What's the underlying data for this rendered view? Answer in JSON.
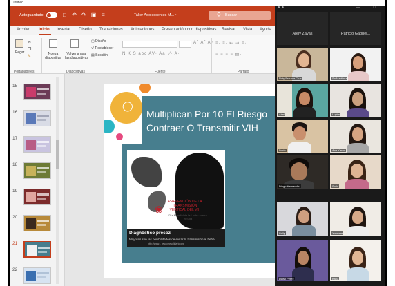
{
  "window": {
    "label": "Untitled"
  },
  "powerpoint": {
    "autosave_label": "Autoguardado",
    "doc_title": "Taller Adolescentes  M... •",
    "search_placeholder": "Buscar",
    "tabs": [
      "Archivo",
      "Inicio",
      "Insertar",
      "Diseño",
      "Transiciones",
      "Animaciones",
      "Presentación con diapositivas",
      "Revisar",
      "Vista",
      "Ayuda"
    ],
    "active_tab": "Inicio",
    "ribbon": {
      "paste": "Pegar",
      "new_slide": "Nueva diapositiva",
      "reuse_slides": "Volver a usar las diapositivas",
      "layout": "Diseño",
      "reset": "Restablecer",
      "section": "Sección",
      "groups": [
        "Portapapeles",
        "Diapositivas",
        "Fuente",
        "Párrafo"
      ]
    },
    "thumbnails": [
      {
        "number": "15",
        "color": "#6b3a56",
        "accent": "#c93b6b"
      },
      {
        "number": "16",
        "color": "#d9dce6",
        "accent": "#5a79b8"
      },
      {
        "number": "17",
        "color": "#c9c4e0",
        "accent": "#b85c86"
      },
      {
        "number": "18",
        "color": "#6d7b36",
        "accent": "#c7b25a"
      },
      {
        "number": "19",
        "color": "#7c2b2b",
        "accent": "#e0a7a0"
      },
      {
        "number": "20",
        "color": "#b88a3a",
        "accent": "#3a2a1e"
      },
      {
        "number": "21",
        "color": "#477e8e",
        "accent": "#1a1a1a",
        "active": true
      },
      {
        "number": "22",
        "color": "#d7e3f1",
        "accent": "#3a6fb0"
      }
    ],
    "slide": {
      "title_line1": "Multiplican Por 10 El Riesgo",
      "title_line2": "Contraer O Transmitir VIH",
      "image_text_1": "PREVENCIÓN DE LA TRANSMISIÓN VERTICAL DEL VIH",
      "image_text_2": "Día Mundial de la Lucha contra el Sida",
      "caption_1": "Diagnóstico precoz",
      "caption_2": "Mayores son las posibilidades de evitar la transmisión al bebé",
      "caption_3": "http://www...  www.mesolidario.org"
    }
  },
  "zoom": {
    "participants": [
      {
        "name": "Arely Zayas",
        "label": "Arely Zayas"
      },
      {
        "name": "Patricio Gabriel...",
        "label": "Patricio Gabriel..."
      },
      {
        "name": "Naty Estrada Cruz",
        "label": "Naty Estrada Cruz"
      },
      {
        "name": "Sn Martinez",
        "label": "Sn Martinez"
      },
      {
        "name": "Abel",
        "label": "Abel"
      },
      {
        "name": "Lupita",
        "label": "Lupita"
      },
      {
        "name": "Dario",
        "label": "Dario"
      },
      {
        "name": "Ana Karen",
        "label": "Ana Karen"
      },
      {
        "name": "Diego Hernandez",
        "label": "Diego Hernandez"
      },
      {
        "name": "Sofia",
        "label": "Sofia"
      },
      {
        "name": "Kelly",
        "label": "Kelly"
      },
      {
        "name": "Vanessa",
        "label": "Vanessa"
      },
      {
        "name": "Daisy Perez",
        "label": "Daisy Perez"
      },
      {
        "name": "Karla",
        "label": "Karla"
      }
    ]
  }
}
